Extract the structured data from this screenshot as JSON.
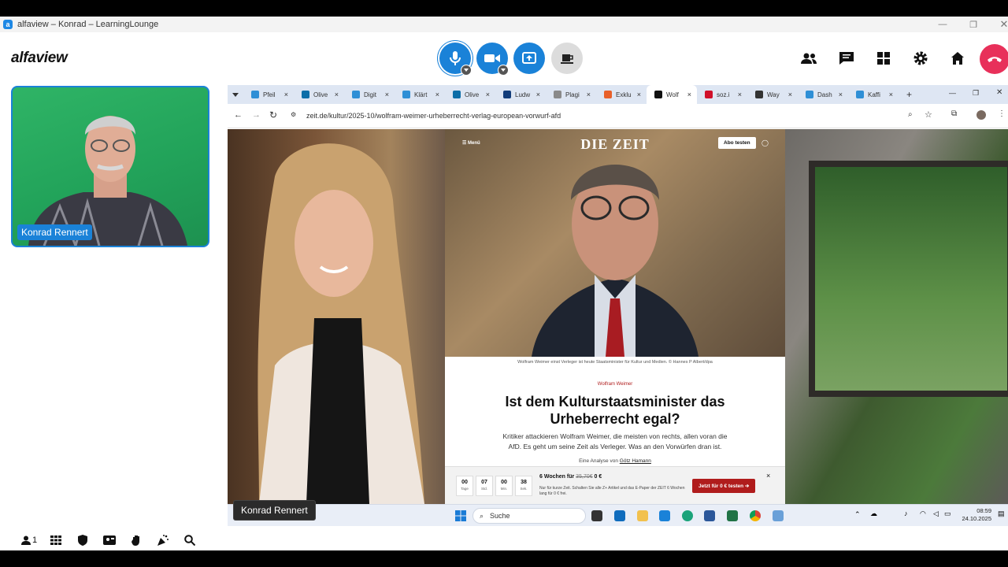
{
  "window": {
    "title": "alfaview – Konrad – LearningLounge",
    "app_icon_letter": "a"
  },
  "logo": "alfaview",
  "controls": {
    "mic": "microphone-icon",
    "camera": "camera-icon",
    "screenshare": "screenshare-icon",
    "whiteboard": "cup-icon"
  },
  "right_icons": [
    "people-icon",
    "chat-icon",
    "grid-icon",
    "gear-icon",
    "home-icon",
    "hangup-icon"
  ],
  "participant": {
    "name": "Konrad Rennert"
  },
  "browser": {
    "tabs": [
      {
        "label": "Pfeil",
        "color": "#2f8fd6"
      },
      {
        "label": "Olive",
        "color": "#0d6ea8"
      },
      {
        "label": "Digit",
        "color": "#2f8fd6"
      },
      {
        "label": "Klärt",
        "color": "#2f8fd6"
      },
      {
        "label": "Olive",
        "color": "#0d6ea8"
      },
      {
        "label": "Ludw",
        "color": "#123c7a"
      },
      {
        "label": "Plagi",
        "color": "#8a8a8a"
      },
      {
        "label": "Exklu",
        "color": "#e8602a"
      },
      {
        "label": "Wolf",
        "color": "#111111",
        "active": true
      },
      {
        "label": "soz.i",
        "color": "#d0102a"
      },
      {
        "label": "Way",
        "color": "#333333"
      },
      {
        "label": "Dash",
        "color": "#2f8fd6"
      },
      {
        "label": "Kaffi",
        "color": "#2f8fd6"
      }
    ],
    "new_tab": "+",
    "url": "zeit.de/kultur/2025-10/wolfram-weimer-urheberrecht-verlag-european-vorwurf-afd"
  },
  "article": {
    "masthead": "DIE ZEIT",
    "menu": "Menü",
    "subscribe": "Abo testen",
    "caption": "Wolfram Weimer einst Verleger ist heute Staatsminister für Kultur und Medien. © Hannes P Albert/dpa",
    "kicker": "Wolfram Weimer",
    "headline": "Ist dem Kulturstaatsminister das Urheberrecht egal?",
    "teaser": "Kritiker attackieren Wolfram Weimer, die meisten von rechts, allen voran die AfD. Es geht um seine Zeit als Verleger. Was an den Vorwürfen dran ist.",
    "byline_prefix": "Eine Analyse von",
    "byline_author": "Götz Hamann"
  },
  "promo": {
    "countdown": [
      {
        "value": "00",
        "unit": "Tage"
      },
      {
        "value": "07",
        "unit": "Std."
      },
      {
        "value": "00",
        "unit": "Min."
      },
      {
        "value": "38",
        "unit": "Sek."
      }
    ],
    "offer_prefix": "6 Wochen für",
    "offer_old_price": "35,70€",
    "offer_new_price": "0 €",
    "offer_text": "Nur für kurze Zeit. Schalten Sie alle Z+ Artikel und das E-Paper der ZEIT 6 Wochen lang für 0 € frei.",
    "cta": "Jetzt für 0 € testen ➔",
    "close": "×"
  },
  "taskbar": {
    "search": "Suche",
    "time": "08:59",
    "date": "24.10.2025"
  },
  "presenter_label": "Konrad Rennert",
  "bottom_bar": {
    "participants_count": "1"
  }
}
